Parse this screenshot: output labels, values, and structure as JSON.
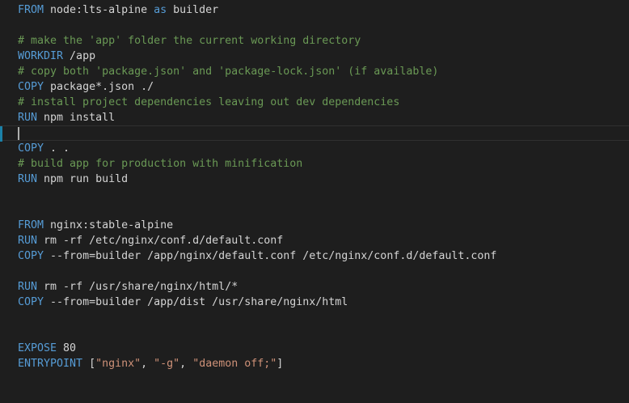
{
  "colors": {
    "background": "#1e1e1e",
    "keyword": "#569cd6",
    "comment": "#6a9955",
    "string": "#ce9178",
    "text": "#d4d4d4",
    "gutter_modified": "#1b81a8"
  },
  "editor": {
    "current_line_index": 8,
    "lines": [
      [
        {
          "t": "kw",
          "v": "FROM"
        },
        {
          "t": "txt",
          "v": " node:lts-alpine "
        },
        {
          "t": "kw",
          "v": "as"
        },
        {
          "t": "txt",
          "v": " builder"
        }
      ],
      [],
      [
        {
          "t": "cm",
          "v": "# make the 'app' folder the current working directory"
        }
      ],
      [
        {
          "t": "kw",
          "v": "WORKDIR"
        },
        {
          "t": "txt",
          "v": " /app"
        }
      ],
      [
        {
          "t": "cm",
          "v": "# copy both 'package.json' and 'package-lock.json' (if available)"
        }
      ],
      [
        {
          "t": "kw",
          "v": "COPY"
        },
        {
          "t": "txt",
          "v": " package*.json ./"
        }
      ],
      [
        {
          "t": "cm",
          "v": "# install project dependencies leaving out dev dependencies"
        }
      ],
      [
        {
          "t": "kw",
          "v": "RUN"
        },
        {
          "t": "txt",
          "v": " npm install"
        }
      ],
      [],
      [
        {
          "t": "kw",
          "v": "COPY"
        },
        {
          "t": "txt",
          "v": " . ."
        }
      ],
      [
        {
          "t": "cm",
          "v": "# build app for production with minification"
        }
      ],
      [
        {
          "t": "kw",
          "v": "RUN"
        },
        {
          "t": "txt",
          "v": " npm run build"
        }
      ],
      [],
      [],
      [
        {
          "t": "kw",
          "v": "FROM"
        },
        {
          "t": "txt",
          "v": " nginx:stable-alpine"
        }
      ],
      [
        {
          "t": "kw",
          "v": "RUN"
        },
        {
          "t": "txt",
          "v": " rm -rf /etc/nginx/conf.d/default.conf"
        }
      ],
      [
        {
          "t": "kw",
          "v": "COPY"
        },
        {
          "t": "txt",
          "v": " --from=builder /app/nginx/default.conf /etc/nginx/conf.d/default.conf"
        }
      ],
      [],
      [
        {
          "t": "kw",
          "v": "RUN"
        },
        {
          "t": "txt",
          "v": " rm -rf /usr/share/nginx/html/*"
        }
      ],
      [
        {
          "t": "kw",
          "v": "COPY"
        },
        {
          "t": "txt",
          "v": " --from=builder /app/dist /usr/share/nginx/html"
        }
      ],
      [],
      [],
      [
        {
          "t": "kw",
          "v": "EXPOSE"
        },
        {
          "t": "txt",
          "v": " 80"
        }
      ],
      [
        {
          "t": "kw",
          "v": "ENTRYPOINT"
        },
        {
          "t": "txt",
          "v": " ["
        },
        {
          "t": "str",
          "v": "\"nginx\""
        },
        {
          "t": "txt",
          "v": ", "
        },
        {
          "t": "str",
          "v": "\"-g\""
        },
        {
          "t": "txt",
          "v": ", "
        },
        {
          "t": "str",
          "v": "\"daemon off;\""
        },
        {
          "t": "txt",
          "v": "]"
        }
      ]
    ]
  }
}
